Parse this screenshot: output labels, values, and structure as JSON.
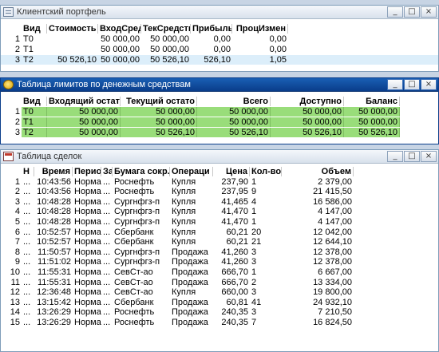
{
  "portfolio": {
    "title": "Клиентский портфель",
    "icon": "portfolio-icon",
    "headers": [
      "Вид",
      "Стоимость",
      "ВходСред",
      "ТекСредств",
      "Прибыль/",
      "ПроцИзмен"
    ],
    "rows": [
      {
        "n": "1",
        "cells": [
          "T0",
          "",
          "50 000,00",
          "50 000,00",
          "0,00",
          "0,00"
        ]
      },
      {
        "n": "2",
        "cells": [
          "T1",
          "",
          "50 000,00",
          "50 000,00",
          "0,00",
          "0,00"
        ]
      },
      {
        "n": "3",
        "cells": [
          "T2",
          "50 526,10",
          "50 000,00",
          "50 526,10",
          "526,10",
          "1,05"
        ]
      }
    ]
  },
  "limits": {
    "title": "Таблица лимитов по денежным средствам",
    "icon": "coin-icon",
    "headers": [
      "Вид",
      "Входящий остат",
      "Текущий остато",
      "Всего",
      "Доступно",
      "Баланс"
    ],
    "rows": [
      {
        "n": "1",
        "cells": [
          "T0",
          "50 000,00",
          "50 000,00",
          "50 000,00",
          "50 000,00",
          "50 000,00"
        ]
      },
      {
        "n": "2",
        "cells": [
          "T1",
          "50 000,00",
          "50 000,00",
          "50 000,00",
          "50 000,00",
          "50 000,00"
        ]
      },
      {
        "n": "3",
        "cells": [
          "T2",
          "50 000,00",
          "50 526,10",
          "50 526,10",
          "50 526,10",
          "50 526,10"
        ]
      }
    ]
  },
  "trades": {
    "title": "Таблица сделок",
    "icon": "trades-icon",
    "headers": [
      "Н",
      "Время",
      "Перио",
      "Зa",
      "Бумага сокр.",
      "Операци",
      "Цена",
      "Кол-во",
      "Объем"
    ],
    "rows": [
      {
        "n": "1",
        "cells": [
          "...",
          "10:43:56",
          "Нормал...",
          "...",
          "Роснефть",
          "Купля",
          "237,90",
          "1",
          "2 379,00"
        ]
      },
      {
        "n": "2",
        "cells": [
          "...",
          "10:43:56",
          "Нормал...",
          "...",
          "Роснефть",
          "Купля",
          "237,95",
          "9",
          "21 415,50"
        ]
      },
      {
        "n": "3",
        "cells": [
          "...",
          "10:48:28",
          "Нормал...",
          "...",
          "Сургнфгз-п",
          "Купля",
          "41,465",
          "4",
          "16 586,00"
        ]
      },
      {
        "n": "4",
        "cells": [
          "...",
          "10:48:28",
          "Нормал...",
          "...",
          "Сургнфгз-п",
          "Купля",
          "41,470",
          "1",
          "4 147,00"
        ]
      },
      {
        "n": "5",
        "cells": [
          "...",
          "10:48:28",
          "Нормал...",
          "...",
          "Сургнфгз-п",
          "Купля",
          "41,470",
          "1",
          "4 147,00"
        ]
      },
      {
        "n": "6",
        "cells": [
          "...",
          "10:52:57",
          "Нормал...",
          "...",
          "Сбербанк",
          "Купля",
          "60,21",
          "20",
          "12 042,00"
        ]
      },
      {
        "n": "7",
        "cells": [
          "...",
          "10:52:57",
          "Нормал...",
          "...",
          "Сбербанк",
          "Купля",
          "60,21",
          "21",
          "12 644,10"
        ]
      },
      {
        "n": "8",
        "cells": [
          "...",
          "11:50:57",
          "Нормал...",
          "...",
          "Сургнфгз-п",
          "Продажа",
          "41,260",
          "3",
          "12 378,00"
        ]
      },
      {
        "n": "9",
        "cells": [
          "...",
          "11:51:02",
          "Нормал...",
          "...",
          "Сургнфгз-п",
          "Продажа",
          "41,260",
          "3",
          "12 378,00"
        ]
      },
      {
        "n": "10",
        "cells": [
          "...",
          "11:55:31",
          "Нормал...",
          "...",
          "СевСт-ао",
          "Продажа",
          "666,70",
          "1",
          "6 667,00"
        ]
      },
      {
        "n": "11",
        "cells": [
          "...",
          "11:55:31",
          "Нормал...",
          "...",
          "СевСт-ао",
          "Продажа",
          "666,70",
          "2",
          "13 334,00"
        ]
      },
      {
        "n": "12",
        "cells": [
          "...",
          "12:36:48",
          "Нормал...",
          "...",
          "СевСт-ао",
          "Купля",
          "660,00",
          "3",
          "19 800,00"
        ]
      },
      {
        "n": "13",
        "cells": [
          "...",
          "13:15:42",
          "Нормал...",
          "...",
          "Сбербанк",
          "Продажа",
          "60,81",
          "41",
          "24 932,10"
        ]
      },
      {
        "n": "14",
        "cells": [
          "...",
          "13:26:29",
          "Нормал...",
          "...",
          "Роснефть",
          "Продажа",
          "240,35",
          "3",
          "7 210,50"
        ]
      },
      {
        "n": "15",
        "cells": [
          "...",
          "13:26:29",
          "Нормал...",
          "...",
          "Роснефть",
          "Продажа",
          "240,35",
          "7",
          "16 824,50"
        ]
      }
    ]
  },
  "window_buttons": {
    "minimize": "_",
    "maximize": "□",
    "close": "×"
  }
}
